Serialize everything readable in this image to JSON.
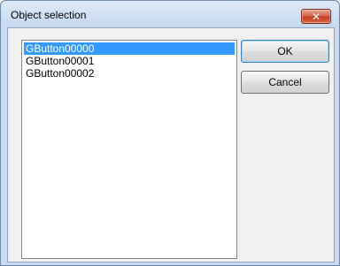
{
  "dialog": {
    "title": "Object selection",
    "close_icon": "close-icon"
  },
  "list": {
    "items": [
      "GButton00000",
      "GButton00001",
      "GButton00002"
    ],
    "selected_index": 0
  },
  "buttons": {
    "ok_label": "OK",
    "cancel_label": "Cancel"
  },
  "colors": {
    "selection": "#3399ff",
    "close_button": "#c23a1c"
  }
}
